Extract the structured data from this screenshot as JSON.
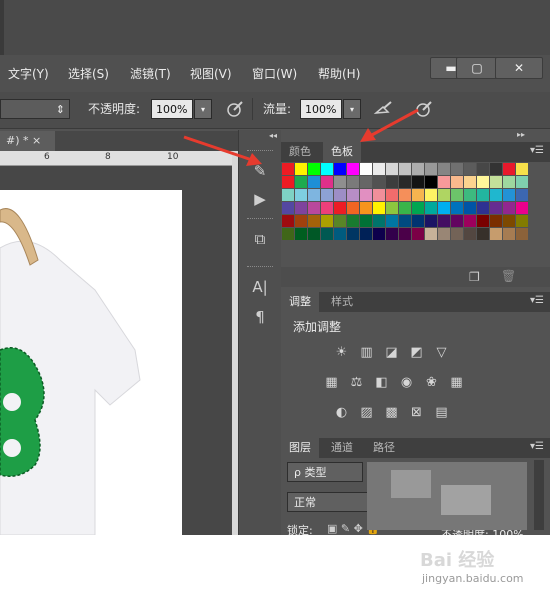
{
  "menu": {
    "items": [
      "文字(Y)",
      "选择(S)",
      "滤镜(T)",
      "视图(V)",
      "窗口(W)",
      "帮助(H)"
    ]
  },
  "window_controls": {
    "minimize": "▬",
    "restore": "▢",
    "close": "✕"
  },
  "options_bar": {
    "opacity_label": "不透明度:",
    "opacity_value": "100%",
    "flow_label": "流量:",
    "flow_value": "100%",
    "dropdown_glyph": "▾",
    "stepper_glyph": "⇕"
  },
  "document": {
    "tab_label": "#) * ×",
    "ruler_ticks": [
      "6",
      "8",
      "10"
    ]
  },
  "panels": {
    "swatches": {
      "tabs": [
        "颜色",
        "色板"
      ],
      "active_tab": "色板",
      "rows": [
        [
          "#ed1c24",
          "#fff200",
          "#00ff00",
          "#00ffff",
          "#0000ff",
          "#ff00ff",
          "#ffffff",
          "#ebebeb",
          "#d6d6d6",
          "#c2c2c2",
          "#adadad",
          "#999999",
          "#858585",
          "#707070",
          "#5c5c5c",
          "#474747",
          "#333333",
          "#e8192c",
          "#f7e04a"
        ],
        [
          "#ed1c24",
          "#1dab4f",
          "#1e8fd6",
          "#e0308a",
          "#8f8f8f",
          "#7a7a7a",
          "#666666",
          "#525252",
          "#3d3d3d",
          "#292929",
          "#141414",
          "#000000",
          "#f79a9a",
          "#f9b98d",
          "#fbd38f",
          "#fff79a",
          "#c3e09a",
          "#9ed79f",
          "#7fd0ae"
        ],
        [
          "#7ed2c4",
          "#7ecee0",
          "#7eb5e0",
          "#8da2d4",
          "#9d8ec6",
          "#b78ec6",
          "#e18fc1",
          "#f08f9a",
          "#f16c6c",
          "#f58f5a",
          "#f7b44f",
          "#fff364",
          "#afd562",
          "#6cc46a",
          "#3dba7f",
          "#22b6a0",
          "#1fb7cf",
          "#2392d6",
          "#3c67b1"
        ],
        [
          "#5447a2",
          "#7f439d",
          "#b9489c",
          "#ed3f7a",
          "#ed1c24",
          "#f26522",
          "#f7941d",
          "#fff200",
          "#8dc63f",
          "#39b54a",
          "#00a651",
          "#00a99d",
          "#00aeef",
          "#0072bc",
          "#0054a6",
          "#2e3192",
          "#662d91",
          "#92278f",
          "#ec008c"
        ],
        [
          "#9e0b0f",
          "#a0410d",
          "#a3620a",
          "#aba000",
          "#598527",
          "#197b30",
          "#007236",
          "#00746b",
          "#0076a3",
          "#004a80",
          "#003471",
          "#1b1464",
          "#440e62",
          "#630460",
          "#9e005d",
          "#790000",
          "#7b2e00",
          "#7d4900",
          "#827b00"
        ],
        [
          "#406618",
          "#005e20",
          "#005826",
          "#005952",
          "#005b7f",
          "#003663",
          "#002157",
          "#0d004c",
          "#32004b",
          "#4b0049",
          "#7b0046",
          "#c7b299",
          "#998675",
          "#736357",
          "#534741",
          "#37302a",
          "#c69c6d",
          "#a67c52",
          "#8c6239"
        ]
      ]
    },
    "adjustments": {
      "tabs": [
        "调整",
        "样式"
      ],
      "active_tab": "调整",
      "title": "添加调整",
      "icon_rows": [
        [
          "brightness-contrast-icon",
          "levels-icon",
          "curves-icon",
          "exposure-icon",
          "vibrance-icon"
        ],
        [
          "hue-saturation-icon",
          "color-balance-icon",
          "black-white-icon",
          "photo-filter-icon",
          "channel-mixer-icon",
          "color-lookup-icon"
        ],
        [
          "invert-icon",
          "posterize-icon",
          "threshold-icon",
          "selective-color-icon",
          "gradient-map-icon"
        ]
      ]
    },
    "layers": {
      "tabs": [
        "图层",
        "通道",
        "路径"
      ],
      "active_tab": "图层",
      "filter_label": "ρ 类型",
      "blend_mode": "正常",
      "lock_label": "锁定:",
      "opacity_fragment": "不透明度: 100%"
    }
  },
  "watermark": {
    "brand": "Bai 经验",
    "url": "jingyan.baidu.com"
  },
  "colors": {
    "arrow": "#e63b2e",
    "panel_bg": "#535353",
    "tshirt_print": "#1e9e46"
  }
}
